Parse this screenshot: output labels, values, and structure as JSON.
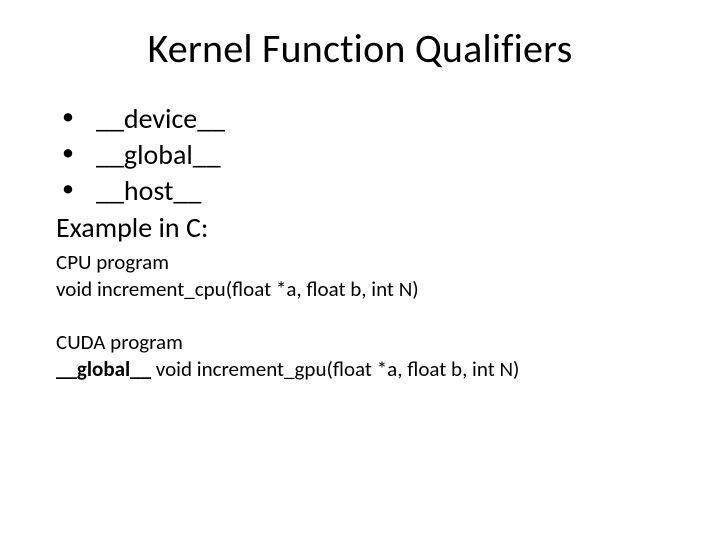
{
  "title": "Kernel Function Qualifiers",
  "bullets": [
    "__device__",
    "__global__",
    "__host__"
  ],
  "example_label": "Example in C:",
  "cpu": {
    "heading": "CPU program",
    "code": "void increment_cpu(float *a, float b, int N)"
  },
  "cuda": {
    "heading": "CUDA program",
    "qualifier": "__global__",
    "code_rest": " void increment_gpu(float *a, float b, int N)"
  }
}
